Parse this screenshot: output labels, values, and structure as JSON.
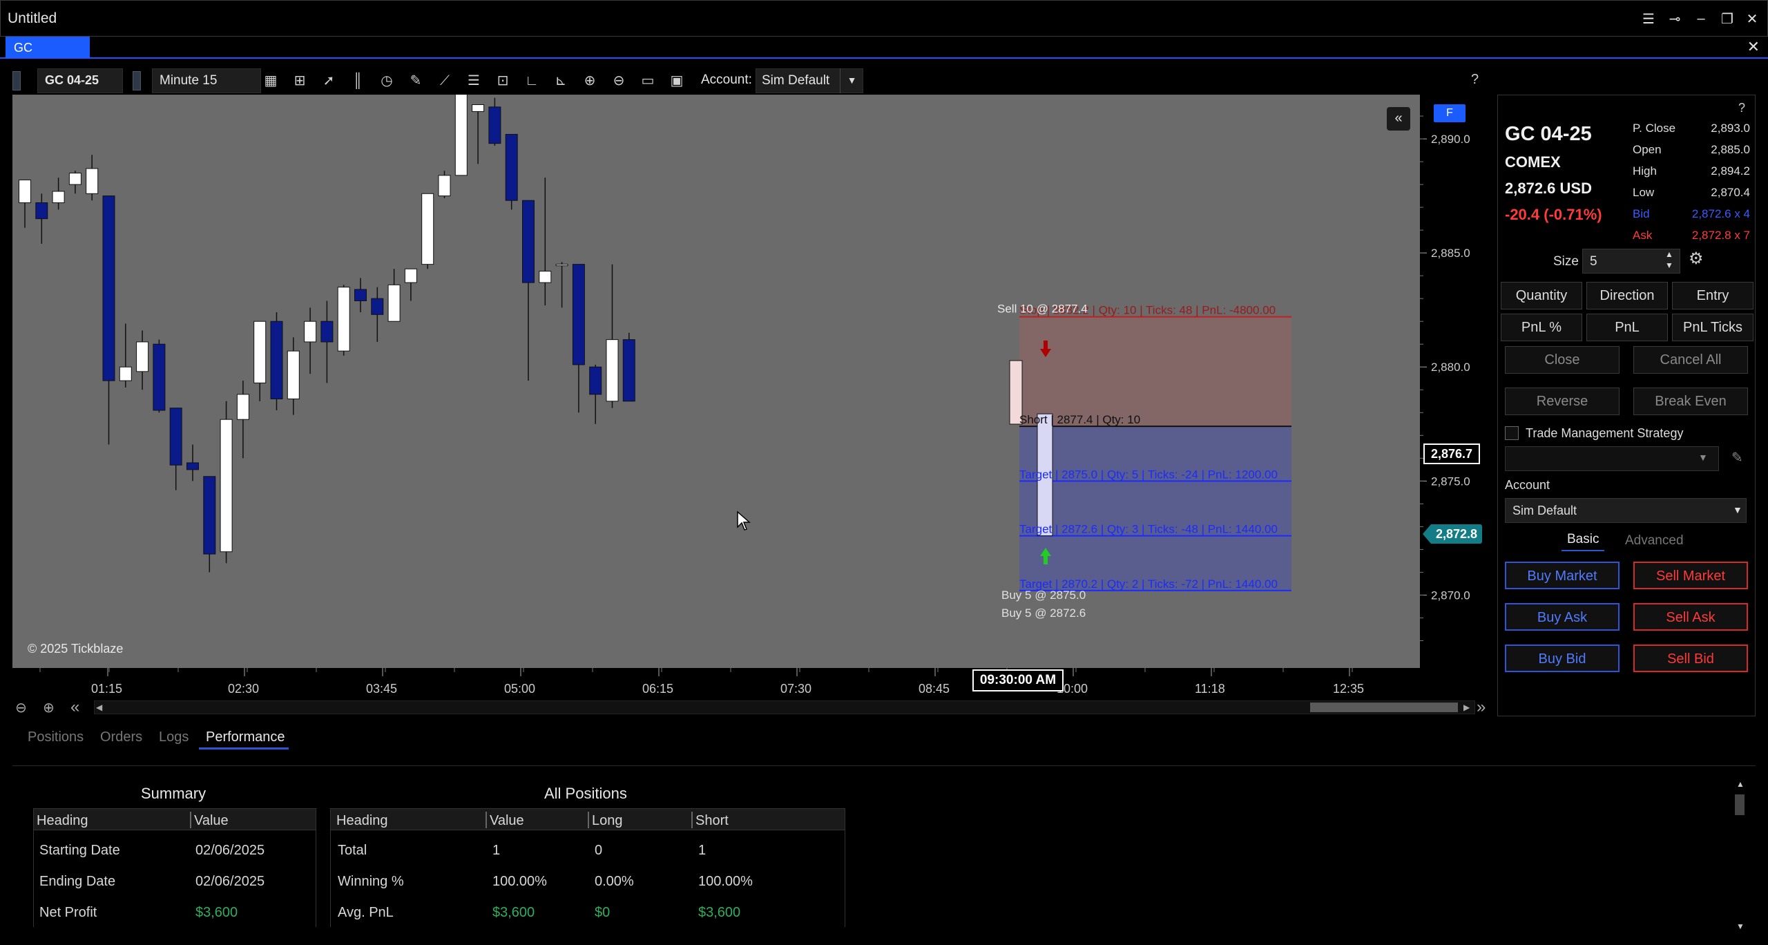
{
  "window": {
    "title": "Untitled",
    "tab_label": "GC"
  },
  "toolbar": {
    "instrument": "GC 04-25",
    "interval": "Minute 15",
    "account_label": "Account:",
    "account_value": "Sim Default",
    "help": "?"
  },
  "chart": {
    "copyright": "© 2025 Tickblaze",
    "f_badge": "F",
    "collapse_icon": "double-chevron-left-icon",
    "price_ticks": [
      "2,890.0",
      "2,885.0",
      "2,880.0",
      "2,875.0",
      "2,870.0"
    ],
    "time_ticks": [
      "01:15",
      "02:30",
      "03:45",
      "05:00",
      "06:15",
      "07:30",
      "08:45",
      "10:00",
      "11:18",
      "12:35"
    ],
    "cursor_time": "09:30:00 AM",
    "crosshair_price": "2,876.7",
    "last_price": "2,872.8",
    "orders": {
      "stop_line": "Stop | 2882.2 | Qty: 10 | Ticks: 48 | PnL: -4800.00",
      "sell_fill": "Sell 10 @ 2877.4",
      "short_line": "Short | 2877.4 | Qty: 10",
      "target1": "Target | 2875.0 | Qty: 5 | Ticks: -24 | PnL: 1200.00",
      "target2": "Target | 2872.6 | Qty: 3 | Ticks: -48 | PnL: 1440.00",
      "target3": "Target | 2870.2 | Qty: 2 | Ticks: -72 | PnL: 1440.00",
      "buy_fill1": "Buy 5 @ 2875.0",
      "buy_fill2": "Buy 5 @ 2872.6"
    }
  },
  "chart_data": {
    "type": "candlestick",
    "ylim": [
      2867.5,
      2892.0
    ],
    "candles": [
      {
        "o": 2887.2,
        "h": 2888.0,
        "l": 2886.1,
        "c": 2888.2
      },
      {
        "o": 2887.2,
        "h": 2887.6,
        "l": 2885.4,
        "c": 2886.5
      },
      {
        "o": 2887.2,
        "h": 2888.3,
        "l": 2886.9,
        "c": 2887.7
      },
      {
        "o": 2888.0,
        "h": 2888.6,
        "l": 2887.6,
        "c": 2888.5
      },
      {
        "o": 2887.6,
        "h": 2889.3,
        "l": 2887.3,
        "c": 2888.7
      },
      {
        "o": 2887.5,
        "h": 2887.5,
        "l": 2876.6,
        "c": 2879.4
      },
      {
        "o": 2879.4,
        "h": 2881.9,
        "l": 2879.1,
        "c": 2880.0
      },
      {
        "o": 2879.8,
        "h": 2881.6,
        "l": 2879.0,
        "c": 2881.1
      },
      {
        "o": 2881.0,
        "h": 2881.2,
        "l": 2878.0,
        "c": 2878.1
      },
      {
        "o": 2878.2,
        "h": 2878.2,
        "l": 2874.6,
        "c": 2875.7
      },
      {
        "o": 2875.8,
        "h": 2876.6,
        "l": 2875.0,
        "c": 2875.5
      },
      {
        "o": 2875.2,
        "h": 2875.2,
        "l": 2871.0,
        "c": 2871.8
      },
      {
        "o": 2871.9,
        "h": 2878.5,
        "l": 2871.4,
        "c": 2877.7
      },
      {
        "o": 2877.7,
        "h": 2879.4,
        "l": 2876.0,
        "c": 2878.8
      },
      {
        "o": 2879.3,
        "h": 2882.0,
        "l": 2878.5,
        "c": 2882.0
      },
      {
        "o": 2882.0,
        "h": 2882.4,
        "l": 2878.1,
        "c": 2878.6
      },
      {
        "o": 2878.6,
        "h": 2881.3,
        "l": 2877.9,
        "c": 2880.7
      },
      {
        "o": 2881.1,
        "h": 2882.6,
        "l": 2879.7,
        "c": 2882.0
      },
      {
        "o": 2882.0,
        "h": 2882.9,
        "l": 2879.3,
        "c": 2881.1
      },
      {
        "o": 2880.7,
        "h": 2883.6,
        "l": 2880.5,
        "c": 2883.5
      },
      {
        "o": 2883.4,
        "h": 2883.9,
        "l": 2882.4,
        "c": 2882.9
      },
      {
        "o": 2883.0,
        "h": 2883.5,
        "l": 2881.1,
        "c": 2882.3
      },
      {
        "o": 2882.0,
        "h": 2884.3,
        "l": 2882.0,
        "c": 2883.6
      },
      {
        "o": 2883.7,
        "h": 2884.3,
        "l": 2882.9,
        "c": 2884.3
      },
      {
        "o": 2884.5,
        "h": 2887.0,
        "l": 2884.3,
        "c": 2887.6
      },
      {
        "o": 2887.5,
        "h": 2888.6,
        "l": 2887.4,
        "c": 2888.4
      },
      {
        "o": 2888.4,
        "h": 2892.0,
        "l": 2888.4,
        "c": 2892.0
      },
      {
        "o": 2891.2,
        "h": 2891.5,
        "l": 2888.9,
        "c": 2891.5
      },
      {
        "o": 2891.4,
        "h": 2891.8,
        "l": 2889.7,
        "c": 2889.8
      },
      {
        "o": 2890.2,
        "h": 2890.2,
        "l": 2886.9,
        "c": 2887.3
      },
      {
        "o": 2887.3,
        "h": 2887.3,
        "l": 2879.4,
        "c": 2883.7
      },
      {
        "o": 2883.7,
        "h": 2888.3,
        "l": 2882.7,
        "c": 2884.2
      },
      {
        "o": 2884.5,
        "h": 2884.6,
        "l": 2882.6,
        "c": 2884.5
      },
      {
        "o": 2884.5,
        "h": 2884.5,
        "l": 2878.0,
        "c": 2880.1
      },
      {
        "o": 2880.0,
        "h": 2880.1,
        "l": 2877.5,
        "c": 2878.8
      },
      {
        "o": 2878.5,
        "h": 2884.5,
        "l": 2878.2,
        "c": 2881.2
      },
      {
        "o": 2881.2,
        "h": 2881.5,
        "l": 2878.5,
        "c": 2878.5
      }
    ],
    "x_ticks": [
      "01:15",
      "02:30",
      "03:45",
      "05:00",
      "06:15",
      "07:30",
      "08:45",
      "10:00",
      "11:18",
      "12:35"
    ],
    "y_ticks": [
      2890.0,
      2885.0,
      2880.0,
      2875.0,
      2870.0
    ],
    "stop_price": 2882.2,
    "entry_price": 2877.4,
    "target_prices": [
      2875.0,
      2872.6,
      2870.2
    ]
  },
  "panel": {
    "help": "?",
    "symbol": "GC 04-25",
    "exchange": "COMEX",
    "last": "2,872.6 USD",
    "change": "-20.4 (-0.71%)",
    "stats": [
      {
        "label": "P. Close",
        "value": "2,893.0"
      },
      {
        "label": "Open",
        "value": "2,885.0"
      },
      {
        "label": "High",
        "value": "2,894.2"
      },
      {
        "label": "Low",
        "value": "2,870.4"
      },
      {
        "label": "Bid",
        "value": "2,872.6 x 4"
      },
      {
        "label": "Ask",
        "value": "2,872.8 x 7"
      }
    ],
    "size_label": "Size",
    "size_value": "5",
    "mode_buttons": [
      "Quantity",
      "Direction",
      "Entry",
      "PnL %",
      "PnL",
      "PnL Ticks"
    ],
    "close": "Close",
    "cancel_all": "Cancel All",
    "reverse": "Reverse",
    "break_even": "Break Even",
    "tms_label": "Trade Management Strategy",
    "account_label": "Account",
    "account_value": "Sim Default",
    "tab_basic": "Basic",
    "tab_advanced": "Advanced",
    "buy_market": "Buy Market",
    "sell_market": "Sell Market",
    "buy_ask": "Buy Ask",
    "sell_ask": "Sell Ask",
    "buy_bid": "Buy Bid",
    "sell_bid": "Sell Bid",
    "colors": {
      "bid": "#3b5bff",
      "ask": "#ff3b3b",
      "change": "#ff3b3b"
    }
  },
  "bottom": {
    "tabs": [
      "Positions",
      "Orders",
      "Logs",
      "Performance"
    ],
    "summary": {
      "title": "Summary",
      "headers": [
        "Heading",
        "Value"
      ],
      "rows": [
        [
          "Starting Date",
          "02/06/2025"
        ],
        [
          "Ending Date",
          "02/06/2025"
        ],
        [
          "Net Profit",
          "$3,600"
        ]
      ]
    },
    "all_positions": {
      "title": "All Positions",
      "headers": [
        "Heading",
        "Value",
        "Long",
        "Short"
      ],
      "rows": [
        [
          "Total",
          "1",
          "0",
          "1"
        ],
        [
          "Winning %",
          "100.00%",
          "0.00%",
          "100.00%"
        ],
        [
          "Avg. PnL",
          "$3,600",
          "$0",
          "$3,600"
        ]
      ]
    }
  }
}
